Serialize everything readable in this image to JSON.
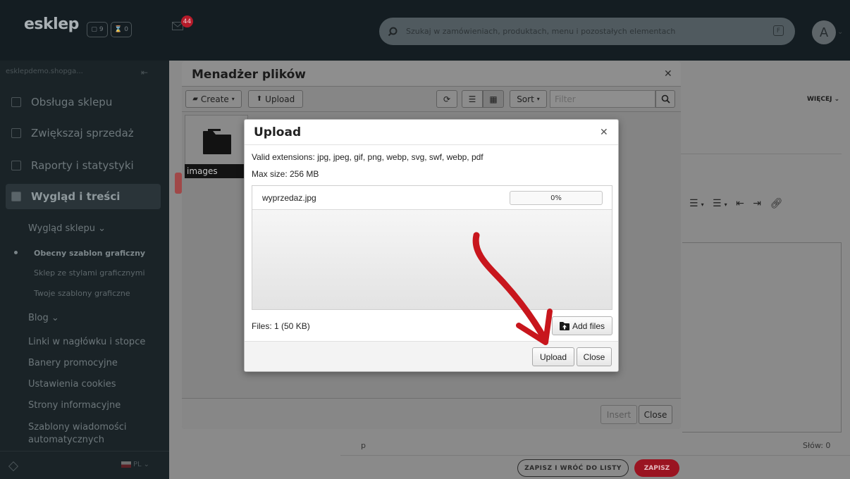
{
  "topbar": {
    "logo": "esklep",
    "badge_orders": "9",
    "badge_pending": "0",
    "mail_count": "44",
    "search_placeholder": "Szukaj w zamówieniach, produktach, menu i pozostałych elementach",
    "shortcut_key": "F",
    "avatar_letter": "A"
  },
  "sidebar": {
    "domain": "esklepdemo.shopga...",
    "items": [
      {
        "label": "Obsługa sklepu"
      },
      {
        "label": "Zwiększaj sprzedaż"
      },
      {
        "label": "Raporty i statystyki"
      },
      {
        "label": "Wygląd i treści"
      }
    ],
    "group1": "Wygląd sklepu",
    "group1_items": [
      "Obecny szablon graficzny",
      "Sklep ze stylami graficznymi",
      "Twoje szablony graficzne"
    ],
    "group2": "Blog",
    "links": [
      "Linki w nagłówku i stopce",
      "Banery promocyjne",
      "Ustawienia cookies",
      "Strony informacyjne",
      "Szablony wiadomości automatycznych"
    ],
    "lang": "PL"
  },
  "page": {
    "more": "WIĘCEJ",
    "editor_path": "p",
    "words": "Słów: 0",
    "back_button": "ZAPISZ I WRÓĆ DO LISTY",
    "save_button": "ZAPISZ"
  },
  "file_manager": {
    "title": "Menadżer plików",
    "create": "Create",
    "upload": "Upload",
    "sort": "Sort",
    "filter_placeholder": "Filter",
    "folder_name": "images",
    "insert": "Insert",
    "close": "Close"
  },
  "upload_dialog": {
    "title": "Upload",
    "extensions": "Valid extensions: jpg, jpeg, gif, png, webp, svg, swf, webp, pdf",
    "max_size": "Max size: 256 MB",
    "file_name": "wyprzedaz.jpg",
    "progress": "0%",
    "files_summary": "Files: 1 (50 KB)",
    "add_files": "Add files",
    "upload_button": "Upload",
    "close_button": "Close"
  },
  "colors": {
    "annotation_arrow": "#c8161d",
    "save_button": "#9a1421",
    "mail_badge": "#b51b2a"
  }
}
